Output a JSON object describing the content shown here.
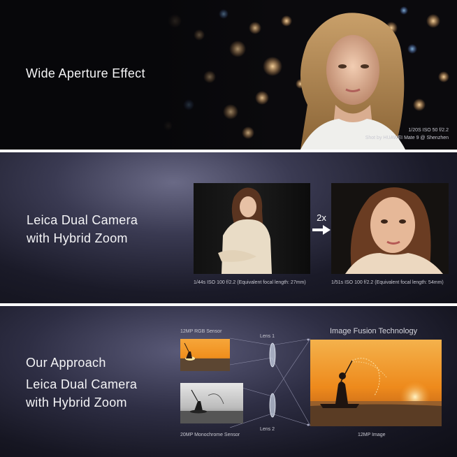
{
  "panel1": {
    "title": "Wide Aperture Effect",
    "exif": "1/20S    ISO 50    f/2.2",
    "credit": "Shot by HUAWEI Mate 9 @   Shenzhen"
  },
  "panel2": {
    "title_line1": "Leica Dual Camera",
    "title_line2": "with Hybrid Zoom",
    "zoom_label": "2x",
    "caption_left": "1/44s    ISO 100   f/2.2 (Equivalent focal length: 27mm)",
    "caption_right": "1/51s   ISO 100   f/2.2 (Equivalent focal length: 54mm)"
  },
  "panel3": {
    "title_line1": "Our Approach",
    "title_line2": "Leica Dual Camera",
    "title_line3": "with Hybrid Zoom",
    "rgb_sensor_label": "12MP RGB Sensor",
    "mono_sensor_label": "20MP Monochrome Sensor",
    "lens1_label": "Lens 1",
    "lens2_label": "Lens 2",
    "fusion_title": "Image Fusion Technology",
    "output_label": "12MP Image"
  },
  "colors": {
    "panel_text": "#f4f4f6",
    "caption_text": "#c9c9d2",
    "sunset_orange": "#f0901e",
    "lens_blue": "#cfd8ea"
  }
}
